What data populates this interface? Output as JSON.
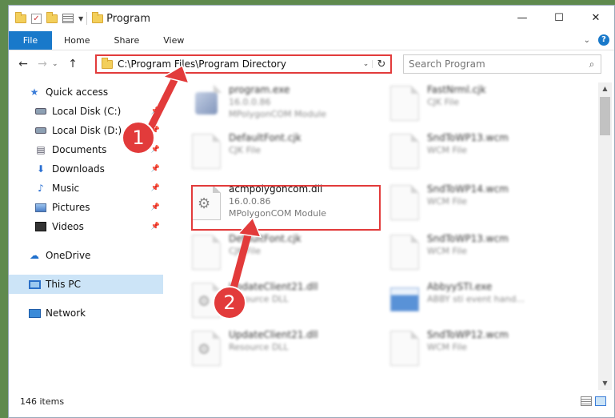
{
  "window": {
    "title": "Program",
    "controls": {
      "minimize": "—",
      "maximize": "☐",
      "close": "✕"
    }
  },
  "ribbon": {
    "tabs": [
      "File",
      "Home",
      "Share",
      "View"
    ],
    "help": "?"
  },
  "address": {
    "path": "C:\\Program Files\\Program Directory",
    "refresh": "↻"
  },
  "search": {
    "placeholder": "Search Program"
  },
  "sidebar": {
    "items": [
      {
        "label": "Quick access"
      },
      {
        "label": "Local Disk (C:)"
      },
      {
        "label": "Local Disk (D:)"
      },
      {
        "label": "Documents"
      },
      {
        "label": "Downloads"
      },
      {
        "label": "Music"
      },
      {
        "label": "Pictures"
      },
      {
        "label": "Videos"
      },
      {
        "label": "OneDrive"
      },
      {
        "label": "This PC"
      },
      {
        "label": "Network"
      }
    ]
  },
  "files": [
    {
      "name": "program.exe",
      "line2": "16.0.0.86",
      "line3": "MPolygonCOM Module"
    },
    {
      "name": "FastNrml.cjk",
      "line2": "CJK File",
      "line3": ""
    },
    {
      "name": "DefaultFont.cjk",
      "line2": "CJK File",
      "line3": ""
    },
    {
      "name": "SndToWP13.wcm",
      "line2": "WCM File",
      "line3": ""
    },
    {
      "name": "acmpolygoncom.dll",
      "line2": "16.0.0.86",
      "line3": "MPolygonCOM Module"
    },
    {
      "name": "SndToWP14.wcm",
      "line2": "WCM File",
      "line3": ""
    },
    {
      "name": "DefaultFont.cjk",
      "line2": "CJK File",
      "line3": ""
    },
    {
      "name": "SndToWP13.wcm",
      "line2": "WCM File",
      "line3": ""
    },
    {
      "name": "UpdateClient21.dll",
      "line2": "Resource DLL",
      "line3": ""
    },
    {
      "name": "AbbyySTI.exe",
      "line2": "ABBY sti event hand...",
      "line3": ""
    },
    {
      "name": "UpdateClient21.dll",
      "line2": "Resource DLL",
      "line3": ""
    },
    {
      "name": "SndToWP12.wcm",
      "line2": "WCM File",
      "line3": ""
    }
  ],
  "status": {
    "items": "146 items"
  },
  "annotations": {
    "step1": "1",
    "step2": "2"
  },
  "colors": {
    "accent": "#1979ca",
    "highlight": "#e23b3b",
    "selected": "#cce4f7"
  }
}
